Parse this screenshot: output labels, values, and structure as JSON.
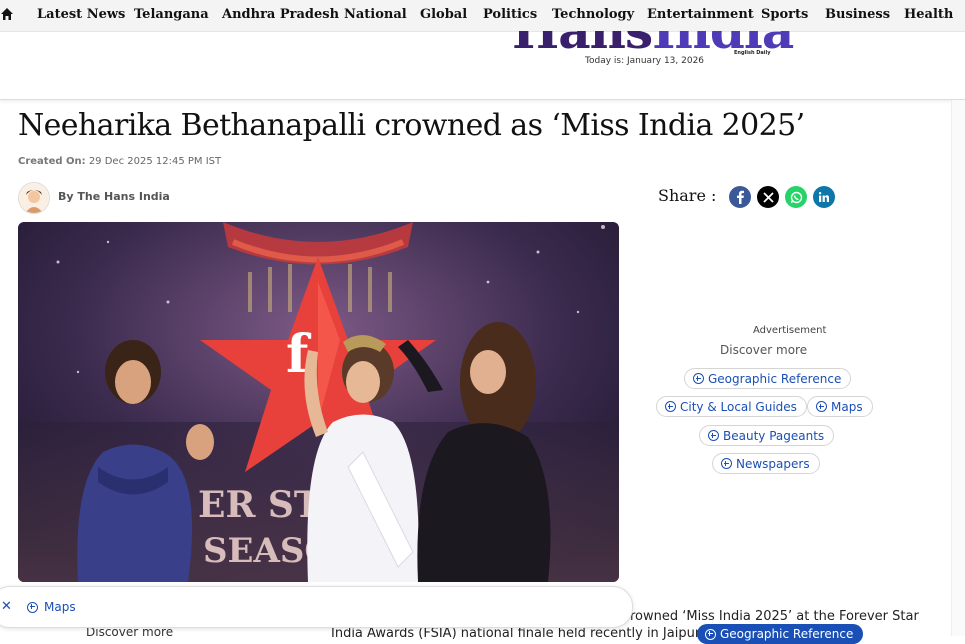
{
  "nav": {
    "items": [
      "Latest News",
      "Telangana",
      "Andhra Pradesh",
      "National",
      "Global",
      "Politics",
      "Technology",
      "Entertainment",
      "Sports",
      "Business",
      "Health"
    ]
  },
  "masthead": {
    "logo_part1": "Hans",
    "logo_part2": "India",
    "logo_tag": "English Daily",
    "today": "Today is: January 13, 2026"
  },
  "article": {
    "title": "Neeharika Bethanapalli crowned as ‘Miss India 2025’",
    "created_label": "Created On:",
    "created_value": "29 Dec 2025 12:45 PM IST",
    "byline": "By The Hans India",
    "body_line1": "rowned ‘Miss India 2025’ at the Forever Star",
    "body_line2": "India Awards (FSIA) national finale held recently in Jaipur"
  },
  "share": {
    "label": "Share :",
    "icons": [
      "facebook-icon",
      "x-icon",
      "whatsapp-icon",
      "linkedin-icon"
    ]
  },
  "sidebar": {
    "ad_label": "Advertisement",
    "discover": "Discover more",
    "chips": [
      "Geographic Reference",
      "City & Local Guides",
      "Maps",
      "Beauty Pageants",
      "Newspapers"
    ]
  },
  "bottom": {
    "maps": "Maps",
    "discover": "Discover more",
    "blue_chip": "Geographic Reference"
  },
  "colors": {
    "accent": "#1a4fb5",
    "logo_dark": "#3a1f6d",
    "logo_light": "#4f3bb8",
    "facebook": "#3b5998",
    "x": "#000000",
    "whatsapp": "#25d366",
    "linkedin": "#0e76a8"
  }
}
